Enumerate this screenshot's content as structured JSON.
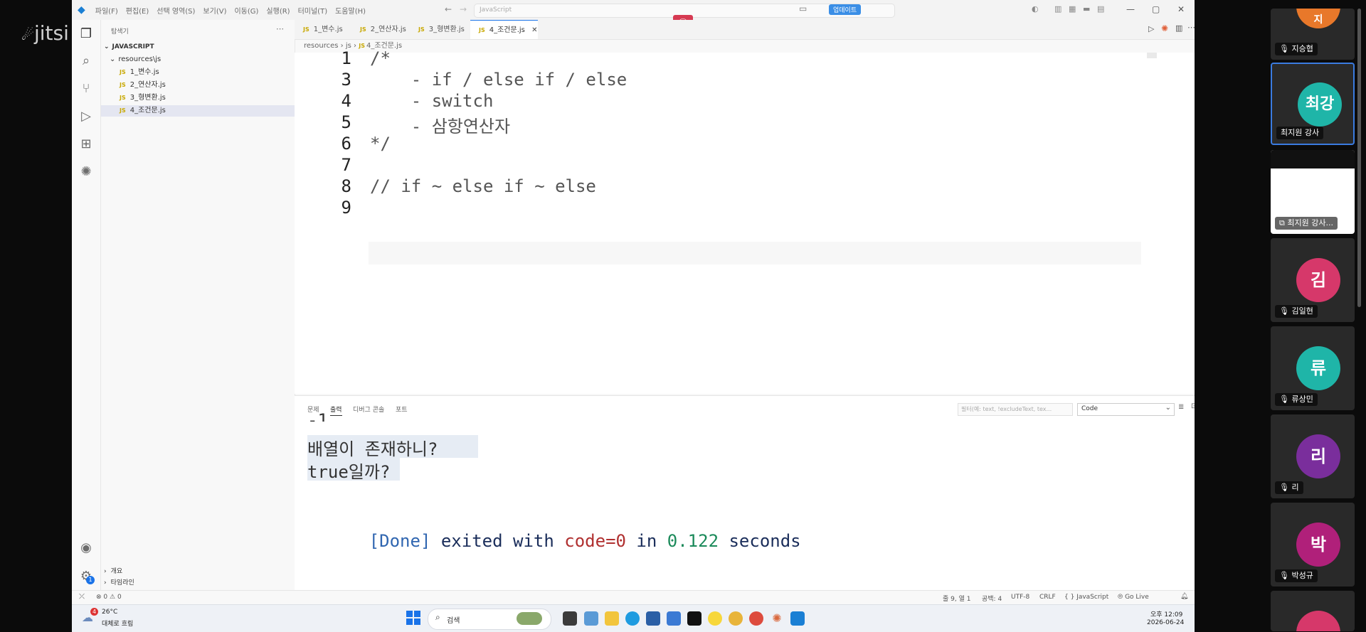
{
  "jitsi": {
    "logo_text": "jitsi"
  },
  "titlebar": {
    "menu": [
      "파일(F)",
      "편집(E)",
      "선택 영역(S)",
      "보기(V)",
      "이동(G)",
      "실행(R)",
      "터미널(T)",
      "도움말(H)"
    ],
    "search_placeholder": "JavaScript",
    "update_label": "업데이트"
  },
  "sidebar": {
    "title": "탐색기",
    "workspace": "JAVASCRIPT",
    "folder": "resources\\js",
    "files": [
      "1_변수.js",
      "2_연산자.js",
      "3_형변환.js",
      "4_조건문.js"
    ],
    "outline": "개요",
    "timeline": "타임라인"
  },
  "tabs": [
    {
      "label": "1_변수.js"
    },
    {
      "label": "2_연산자.js"
    },
    {
      "label": "3_형변환.js"
    },
    {
      "label": "4_조건문.js"
    }
  ],
  "breadcrumb": {
    "p1": "resources",
    "p2": "js",
    "p3": "4_조건문.js"
  },
  "editor": {
    "lines": [
      {
        "num": "1",
        "text": "/*"
      },
      {
        "num": "3",
        "text": "    - if / else if / else"
      },
      {
        "num": "4",
        "text": "    - switch"
      },
      {
        "num": "5",
        "text": "    - 삼항연산자"
      },
      {
        "num": "6",
        "text": "*/"
      },
      {
        "num": "7",
        "text": ""
      },
      {
        "num": "8",
        "text": "// if ~ else if ~ else"
      },
      {
        "num": "9",
        "text": ""
      }
    ]
  },
  "panel": {
    "tabs": [
      "문제",
      "출력",
      "디버그 콘솔",
      "포트"
    ],
    "filter_placeholder": "필터(예: text, !excludeText, tex...",
    "channel": "Code",
    "output": {
      "line0": "-1",
      "line1": "배열이 존재하니?",
      "line2": "true일까?",
      "done": "[Done]",
      "exited": "exited with",
      "code": "code=0",
      "in": "in",
      "secs": "0.122",
      "seconds": "seconds"
    }
  },
  "statusbar": {
    "errors": "0",
    "warnings": "0",
    "position": "줄 9, 열 1",
    "spaces": "공백: 4",
    "encoding": "UTF-8",
    "eol": "CRLF",
    "language": "JavaScript",
    "golive": "Go Live"
  },
  "taskbar": {
    "weather_temp": "26°C",
    "weather_desc": "대체로 흐림",
    "weather_badge": "4",
    "search": "검색",
    "time": "오후 12:09",
    "date": "2026-06-24",
    "gear_badge": "1"
  },
  "participants": [
    {
      "name": "지승협",
      "initial": "지",
      "color": "#e8782a"
    },
    {
      "name": "최지원 강사",
      "initial": "최강",
      "color": "#1fb5a8"
    },
    {
      "name": "최지원 강사..."
    },
    {
      "name": "김일현",
      "initial": "김",
      "color": "#d6386a"
    },
    {
      "name": "류상민",
      "initial": "류",
      "color": "#1fb5a8"
    },
    {
      "name": "리",
      "initial": "리",
      "color": "#7a2e9c"
    },
    {
      "name": "박성규",
      "initial": "박",
      "color": "#b0207a"
    }
  ]
}
